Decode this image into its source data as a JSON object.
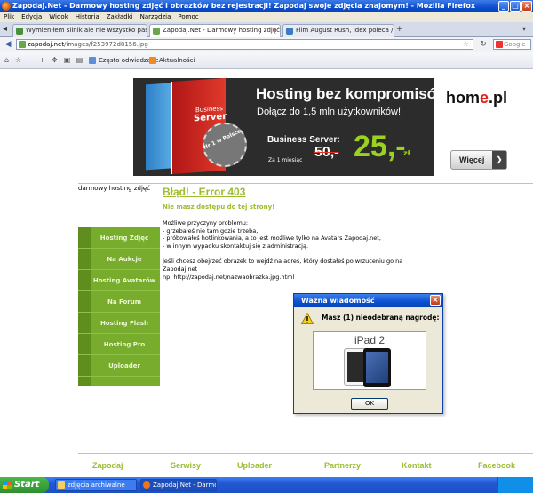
{
  "window": {
    "title": "Zapodaj.Net - Darmowy hosting zdjęć i obrazków bez rejestracji! Zapodaj swoje zdjęcia znajomym! - Mozilla Firefox"
  },
  "menu": [
    "Plik",
    "Edycja",
    "Widok",
    "Historia",
    "Zakładki",
    "Narzędzia",
    "Pomoc"
  ],
  "tabs": [
    {
      "label": "Wymieniłem silnik ale nie wszystko pasuje ...",
      "active": false
    },
    {
      "label": "Zapodaj.Net - Darmowy hosting zdjęć i o...",
      "active": true
    },
    {
      "label": "Film August Rush, Idex poleca / Nagradz...",
      "active": false
    }
  ],
  "address": {
    "host": "zapodaj.net",
    "path": "/images/f253972d8156.jpg"
  },
  "search": {
    "placeholder": "Google"
  },
  "bookmarks": [
    "Często odwiedzane",
    "Aktualności"
  ],
  "banner": {
    "box_label": "Business",
    "box_title": "Server",
    "seal_text": "Nr 1 w Polsce",
    "headline": "Hosting bez kompromisów",
    "subline": "Dołącz do 1,5 mln użytkowników!",
    "product": "Business Server:",
    "period": "Za 1 miesiąc",
    "old_price": "50,-",
    "new_price": "25,-",
    "currency": "zł",
    "brand_prefix": "hom",
    "brand_accent": "e",
    "brand_suffix": ".pl",
    "more_button": "Więcej"
  },
  "site": {
    "logo_text": "darmowy hosting zdjęć"
  },
  "sidebar": {
    "items": [
      {
        "label": "Hosting Zdjęć"
      },
      {
        "label": "Na Aukcje"
      },
      {
        "label": "Hosting Avatarów"
      },
      {
        "label": "Na Forum"
      },
      {
        "label": "Hosting Flash"
      },
      {
        "label": "Hosting Pro"
      },
      {
        "label": "Uploader"
      }
    ]
  },
  "content": {
    "error_title": "Błąd! - Error 403",
    "error_subtitle": "Nie masz dostępu do tej strony!",
    "reasons_heading": "Możliwe przyczyny problemu:",
    "reason_1": "- grzebałeś nie tam gdzie trzeba,",
    "reason_2": "- próbowałeś hotlinkowania, a to jest możliwe tylko na Avatars Zapodaj.net,",
    "reason_3": "- w innym wypadku skontaktuj się z administracją.",
    "hint_1": "Jeśli chcesz obejrzeć obrazek to wejdź na adres, który dostałeś po wrzuceniu go na Zapodaj.net",
    "hint_2": "np. http://zapodaj.net/nazwaobrazka.jpg.html"
  },
  "dialog": {
    "title": "Ważna wiadomość",
    "message": "Masz (1) nieodebraną nagrodę:",
    "prize_label": "iPad 2",
    "ok_button": "OK"
  },
  "footer": {
    "links": [
      "Zapodaj",
      "Serwisy",
      "Uploader",
      "Partnerzy",
      "Kontakt",
      "Facebook"
    ]
  },
  "taskbar": {
    "start_label": "Start",
    "items": [
      {
        "label": "zdjęcia archiwalne",
        "active": false
      },
      {
        "label": "Zapodaj.Net - Darmo...",
        "active": true
      }
    ]
  },
  "colors": {
    "accent_green": "#9bbd2f",
    "sidebar_green": "#78ac2c",
    "xp_blue": "#0a4fd0"
  }
}
